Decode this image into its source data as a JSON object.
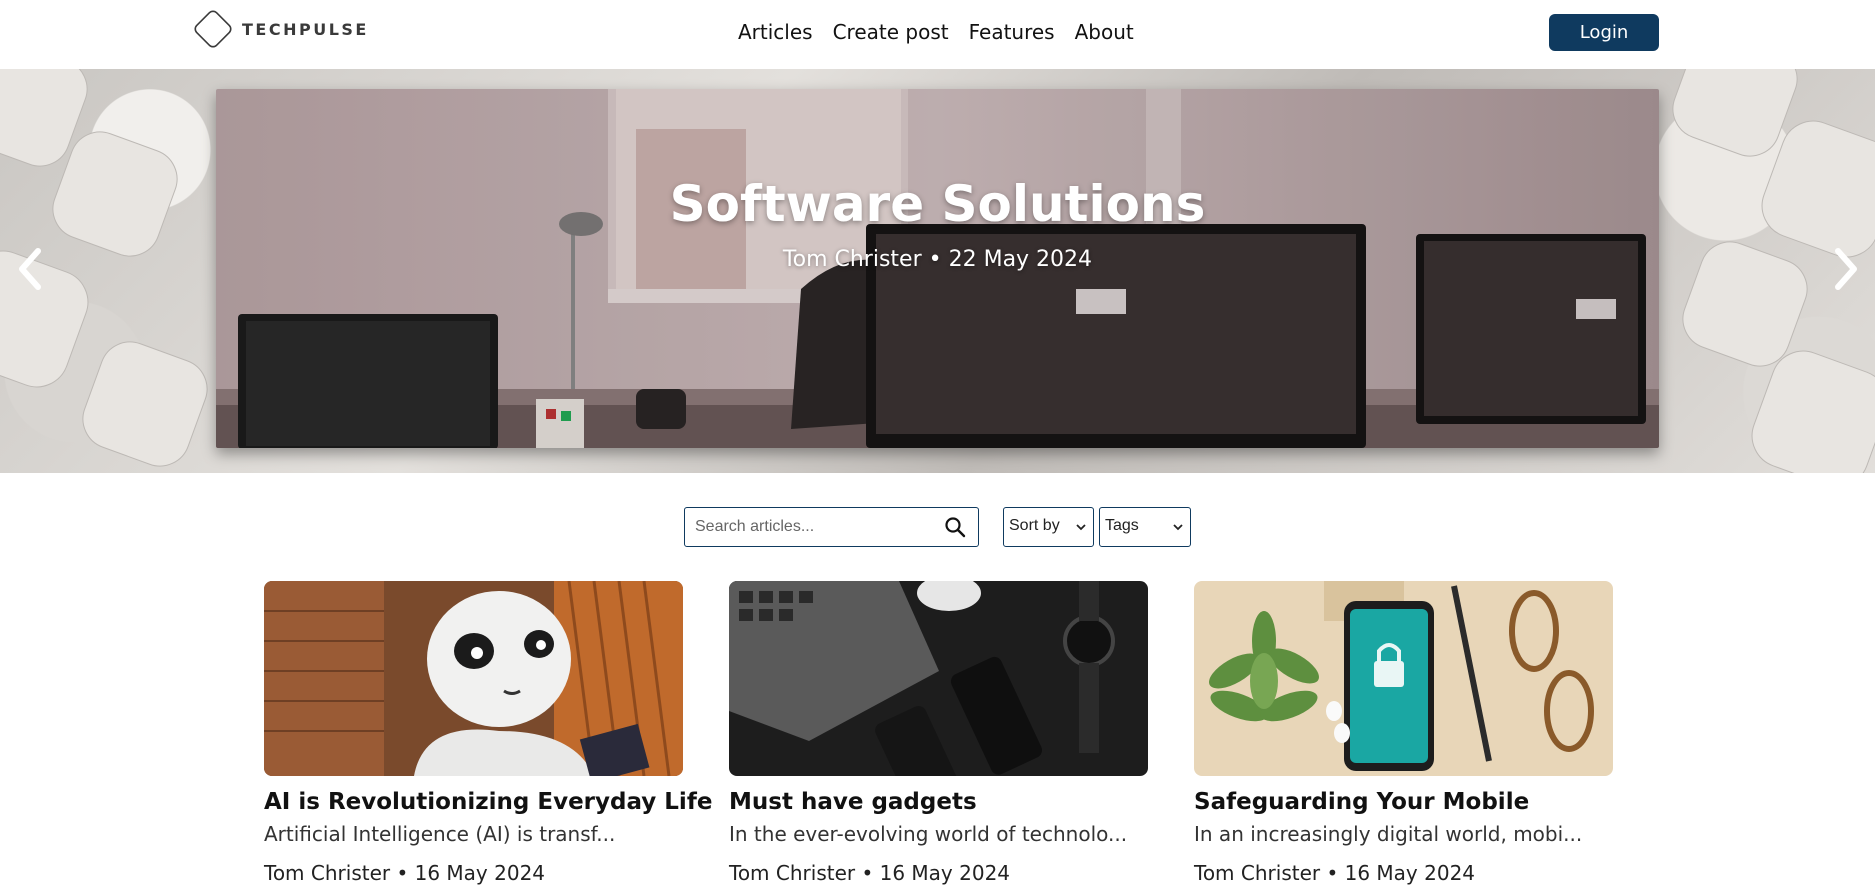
{
  "brand": {
    "name": "TECHPULSE"
  },
  "nav": {
    "items": [
      "Articles",
      "Create post",
      "Features",
      "About"
    ]
  },
  "header": {
    "login_label": "Login"
  },
  "hero": {
    "title": "Software Solutions",
    "meta": "Tom Christer • 22 May 2024"
  },
  "controls": {
    "search_placeholder": "Search articles...",
    "sort_label": "Sort by",
    "tags_label": "Tags"
  },
  "cards": [
    {
      "title": "AI is Revolutionizing Everyday Life",
      "excerpt": "Artificial Intelligence (AI) is transf...",
      "meta": "Tom Christer • 16 May 2024",
      "image": "robot-photo"
    },
    {
      "title": "Must have gadgets",
      "excerpt": "In the ever-evolving world of technolo...",
      "meta": "Tom Christer • 16 May 2024",
      "image": "gadgets-photo"
    },
    {
      "title": "Safeguarding Your Mobile",
      "excerpt": "In an increasingly digital world, mobi...",
      "meta": "Tom Christer • 16 May 2024",
      "image": "mobile-security-photo"
    }
  ],
  "colors": {
    "primary": "#0f3a5f",
    "text": "#111111",
    "background": "#ffffff"
  }
}
